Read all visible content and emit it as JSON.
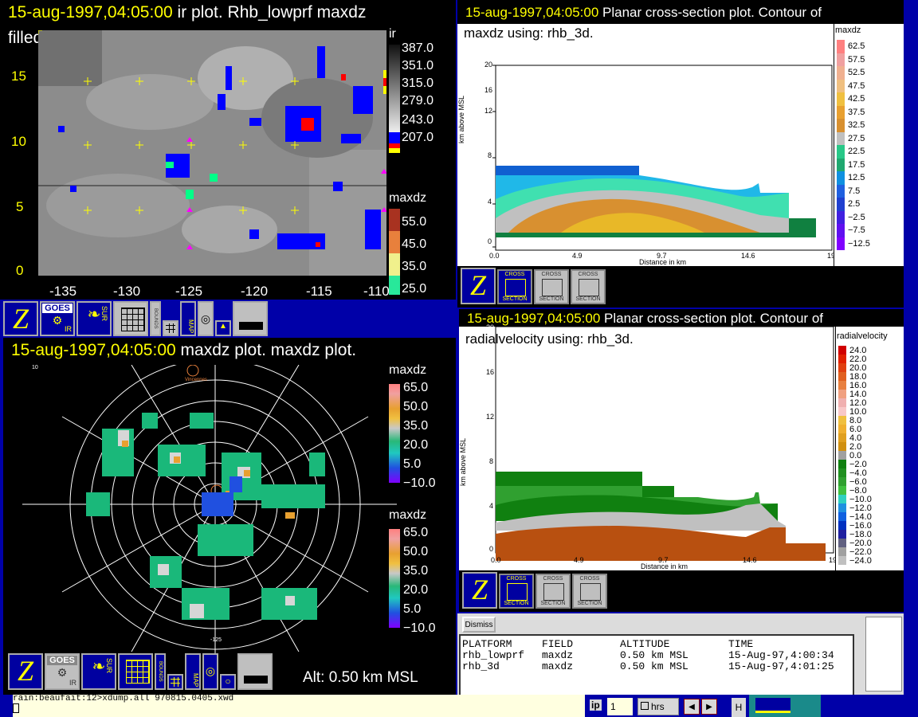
{
  "ir_window": {
    "title_time": "15-aug-1997,04:05:00",
    "title_rest": " ir plot.  Rhb_lowprf maxdz",
    "title_line2": "filled contour.",
    "y_ticks": [
      "15",
      "10",
      "5",
      "0"
    ],
    "x_ticks": [
      "-135",
      "-130",
      "-125",
      "-120",
      "-115",
      "-110"
    ],
    "colorbar_ir": {
      "title": "ir",
      "labels": [
        "387.0",
        "351.0",
        "315.0",
        "279.0",
        "243.0",
        "207.0"
      ]
    },
    "colorbar_maxdz": {
      "title": "maxdz",
      "labels": [
        "55.0",
        "45.0",
        "35.0",
        "25.0"
      ]
    }
  },
  "toolbar_top": {
    "z": "Z",
    "goes": "GOES",
    "ir": "IR",
    "sur": "SUR",
    "bounds": "BOUNDS",
    "map": "MAP"
  },
  "radar_window": {
    "title_time": "15-aug-1997,04:05:00",
    "title_rest": " maxdz plot.  maxdz plot.",
    "colorbar1": {
      "title": "maxdz",
      "labels": [
        "65.0",
        "50.0",
        "35.0",
        "20.0",
        "5.0",
        "−10.0"
      ]
    },
    "colorbar2": {
      "title": "maxdz",
      "labels": [
        "65.0",
        "50.0",
        "35.0",
        "20.0",
        "5.0",
        "−10.0"
      ]
    },
    "altitude": "Alt: 0.50 km MSL",
    "top_label": "10",
    "bottom_label": "-125",
    "vessel_label": "Vincennes"
  },
  "toolbar_bottom": {
    "z": "Z",
    "goes": "GOES",
    "ir": "IR",
    "sur": "SUR",
    "bounds": "BOUNDS",
    "map": "MAP"
  },
  "xsec1": {
    "title_time": "15-aug-1997,04:05:00",
    "title_rest": "  Planar cross-section plot.  Contour of",
    "title_line2": "maxdz using: rhb_3d.",
    "ylabel": "km above MSL",
    "xlabel": "Distance in km",
    "y_ticks": [
      "20",
      "16",
      "12",
      "8",
      "4",
      "0"
    ],
    "x_ticks": [
      "0.0",
      "4.9",
      "9.7",
      "14.6",
      "19"
    ],
    "colorbar": {
      "title": "maxdz",
      "labels": [
        "62.5",
        "57.5",
        "52.5",
        "47.5",
        "42.5",
        "37.5",
        "32.5",
        "27.5",
        "22.5",
        "17.5",
        "12.5",
        "7.5",
        "2.5",
        "−2.5",
        "−7.5",
        "−12.5"
      ]
    },
    "buttons": [
      {
        "t1": "CROSS",
        "t2": "SECTION"
      },
      {
        "t1": "CROSS",
        "t2": "SECTION"
      },
      {
        "t1": "CROSS",
        "t2": "SECTION"
      }
    ]
  },
  "xsec2": {
    "title_time": "15-aug-1997,04:05:00",
    "title_rest": "  Planar cross-section plot.  Contour of",
    "title_line2": "radialvelocity using: rhb_3d.",
    "ylabel": "km above MSL",
    "xlabel": "Distance in km",
    "y_ticks": [
      "20",
      "16",
      "12",
      "8",
      "4",
      "0"
    ],
    "x_ticks": [
      "0.0",
      "4.9",
      "9.7",
      "14.6",
      "19"
    ],
    "colorbar": {
      "title": "radialvelocity",
      "labels": [
        "24.0",
        "22.0",
        "20.0",
        "18.0",
        "16.0",
        "14.0",
        "12.0",
        "10.0",
        "8.0",
        "6.0",
        "4.0",
        "2.0",
        "0.0",
        "−2.0",
        "−4.0",
        "−6.0",
        "−8.0",
        "−10.0",
        "−12.0",
        "−14.0",
        "−16.0",
        "−18.0",
        "−20.0",
        "−22.0",
        "−24.0"
      ]
    },
    "buttons": [
      {
        "t1": "CROSS",
        "t2": "SECTION"
      },
      {
        "t1": "CROSS",
        "t2": "SECTION"
      },
      {
        "t1": "CROSS",
        "t2": "SECTION"
      }
    ]
  },
  "info": {
    "dismiss": "Dismiss",
    "headers": [
      "PLATFORM",
      "FIELD",
      "ALTITUDE",
      "TIME"
    ],
    "rows": [
      [
        "rhb_lowprf",
        "maxdz",
        "0.50 km MSL",
        "15-Aug-97,4:00:34"
      ],
      [
        "rhb_3d",
        "maxdz",
        "0.50 km MSL",
        "15-Aug-97,4:01:25"
      ]
    ]
  },
  "terminal": {
    "line1": "rain:beaufait:12>xdump.all 970815.0405.xwd",
    "line2": ""
  },
  "taskbar": {
    "label_ip": "ip",
    "field_value": "1",
    "hrs": "hrs",
    "h": "H"
  }
}
